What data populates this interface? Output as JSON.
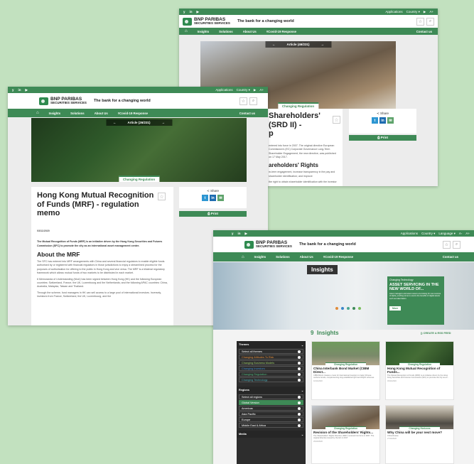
{
  "brand": {
    "name": "BNP PARIBAS",
    "sub": "SECURITIES SERVICES",
    "tagline": "The bank for a changing world"
  },
  "topbar": {
    "social": [
      "y",
      "in",
      "▶"
    ],
    "items": [
      "Applications",
      "Country ▾",
      "▶",
      "A+"
    ],
    "items_insights": [
      "Applications",
      "Country ▾",
      "Language ▾",
      "A-",
      "A+"
    ]
  },
  "nav": {
    "items": [
      "Insights",
      "Solutions",
      "About Us",
      "#Covid-19 Response"
    ],
    "contact": "Contact us"
  },
  "colors": {
    "brand_green": "#3e8a56",
    "background": "#c2e1bf"
  },
  "article1": {
    "counter": "Article (26/231)",
    "badge": "Changing Regulation",
    "title": "Hong Kong Mutual Recognition of Funds (MRF) - regulation memo",
    "date": "03/11/2020",
    "intro": "The Mutual Recognition of Funds (MRF) is an initiative driven by the Hong Kong Securities and Futures Commission (SFC) to promote the city as an international asset management centre.",
    "section": "About the MRF",
    "p1": "The SFC has entered into MRF arrangements with China and several financial regulators to enable eligible funds authorised by or registered with financial regulators in those jurisdictions to enjoy a streamlined process for the purposes of authorisation for offering to the public in Hong Kong and vice versa. The MRF is a bilateral regulatory framework which allows mutual funds of two markets to be distributed in each market.",
    "p2": "6 Memoranda of Understanding (MoU) has been signed between Hong Kong (HK) and the following European countries: Switzerland, France, the UK, Luxembourg and the Netherlands; and the following APAC countries: China, Australia, Malaysia, Taiwan and Thailand.",
    "p3": "Through the scheme, fund managers in HK can sell access to a large pool of international investors. Inversely, investors from France, Switzerland, the UK, Luxembourg, and the",
    "share": "Share",
    "print": "Print"
  },
  "article2": {
    "counter": "Article (46/231)",
    "badge": "Changing Regulation",
    "title_lines": [
      "Shareholders'",
      "(SRD II) -",
      "p"
    ],
    "section": "areholders' Rights",
    "body1": "entered into force in 2007. The original directive European Commission's (EC) Corporate Governance Long-Term Shareholder Engagement, the new directive, was published on 17 May 2017.",
    "body2": "m-term engagement, increase transparency in the pay and shareholder identification; and improve",
    "body3": "the right to obtain shareholder identification with the investor",
    "share": "Share",
    "print": "Print"
  },
  "insights": {
    "hero_label": "Insights",
    "promo": {
      "tag": "Changing Technology",
      "title": "ASSET SERVICING IN THE NEW WORLD OF...",
      "text": "Asset managers and asset owners are looking for new sources of alpha, pushing some to source the benefits of digital assets such as tokenization.",
      "more": "More"
    },
    "count": "9",
    "heading": "Insights",
    "rss": "CREATE A RSS FEED",
    "themes": {
      "title": "Themes",
      "items": [
        "Select all themes",
        "Changing Attitudes To Risk",
        "Changing Business Models",
        "Changing Investors",
        "Changing Regulation",
        "Changing Technology"
      ]
    },
    "regions": {
      "title": "Regions",
      "items": [
        "Select all regions",
        "Global Version",
        "Americas",
        "Asia Pacific",
        "Europe",
        "Middle East & Africa"
      ]
    },
    "media": {
      "title": "Media"
    },
    "cards": [
      {
        "badge": "Changing Regulation",
        "title": "China Interbank Bond Market (CIBM Direct...",
        "desc": "CIBM Direct creates a route for international investors to trade Chinese onshore bonds, complementing long established QFII and RQFII schemes.",
        "date": "10/11/2020"
      },
      {
        "badge": "Changing Regulation",
        "title": "Hong Kong Mutual Recognition of Funds...",
        "desc": "The Mutual Recognition of Funds (MRF) is an initiative driven by the Hong Kong Securities and Futures Commission (SFC) to promote the city as an...",
        "date": "03/11/2020"
      },
      {
        "badge": "Changing Regulation",
        "title": "Revision of the Shareholders' Rights...",
        "desc": "The Shareholders' Rights Directive (SRD I) entered into force in 2007. The original directive issued by the EC in 2017.",
        "date": "29/10/2020"
      },
      {
        "badge": "Changing Horizons",
        "title": "Why China will be your next move?",
        "desc": "China Russia",
        "date": "27/10/2020"
      }
    ]
  }
}
